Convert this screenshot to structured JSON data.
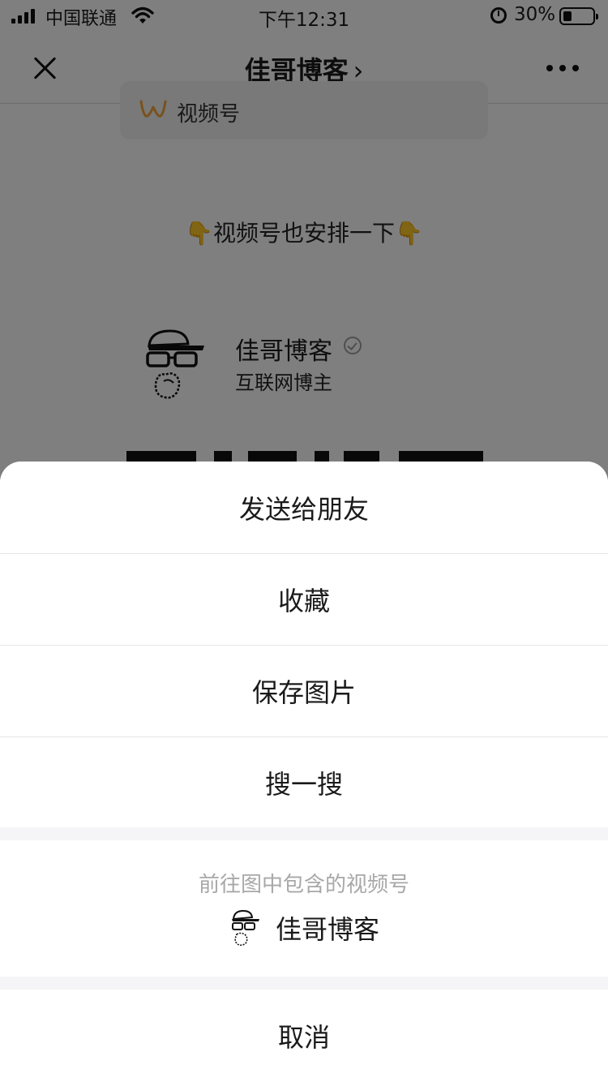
{
  "status_bar": {
    "carrier": "中国联通",
    "time": "下午12:31",
    "battery_percent": "30%",
    "battery_level": 0.3
  },
  "nav": {
    "title": "佳哥博客",
    "chevron": "›"
  },
  "content": {
    "channel_label": "视频号",
    "promo_text": "视频号也安排一下",
    "author_name": "佳哥博客",
    "author_subtitle": "互联网博主"
  },
  "action_sheet": {
    "options": [
      {
        "label": "发送给朋友"
      },
      {
        "label": "收藏"
      },
      {
        "label": "保存图片"
      },
      {
        "label": "搜一搜"
      }
    ],
    "goto_label": "前往图中包含的视频号",
    "goto_name": "佳哥博客",
    "cancel_label": "取消"
  },
  "icons": {
    "signal": "signal-bars-icon",
    "wifi": "wifi-icon",
    "alarm": "alarm-icon",
    "battery": "battery-icon",
    "close": "close-icon",
    "more": "more-dots-icon",
    "channels": "channels-logo-icon",
    "pointing_hand": "pointing-down-hand-icon",
    "verified": "verified-badge-icon"
  },
  "colors": {
    "overlay": "rgba(0,0,0,0.5)",
    "channel_logo": "#f4a23a",
    "muted_text": "#a8a8a8",
    "sheet_background": "#f5f5f7"
  }
}
